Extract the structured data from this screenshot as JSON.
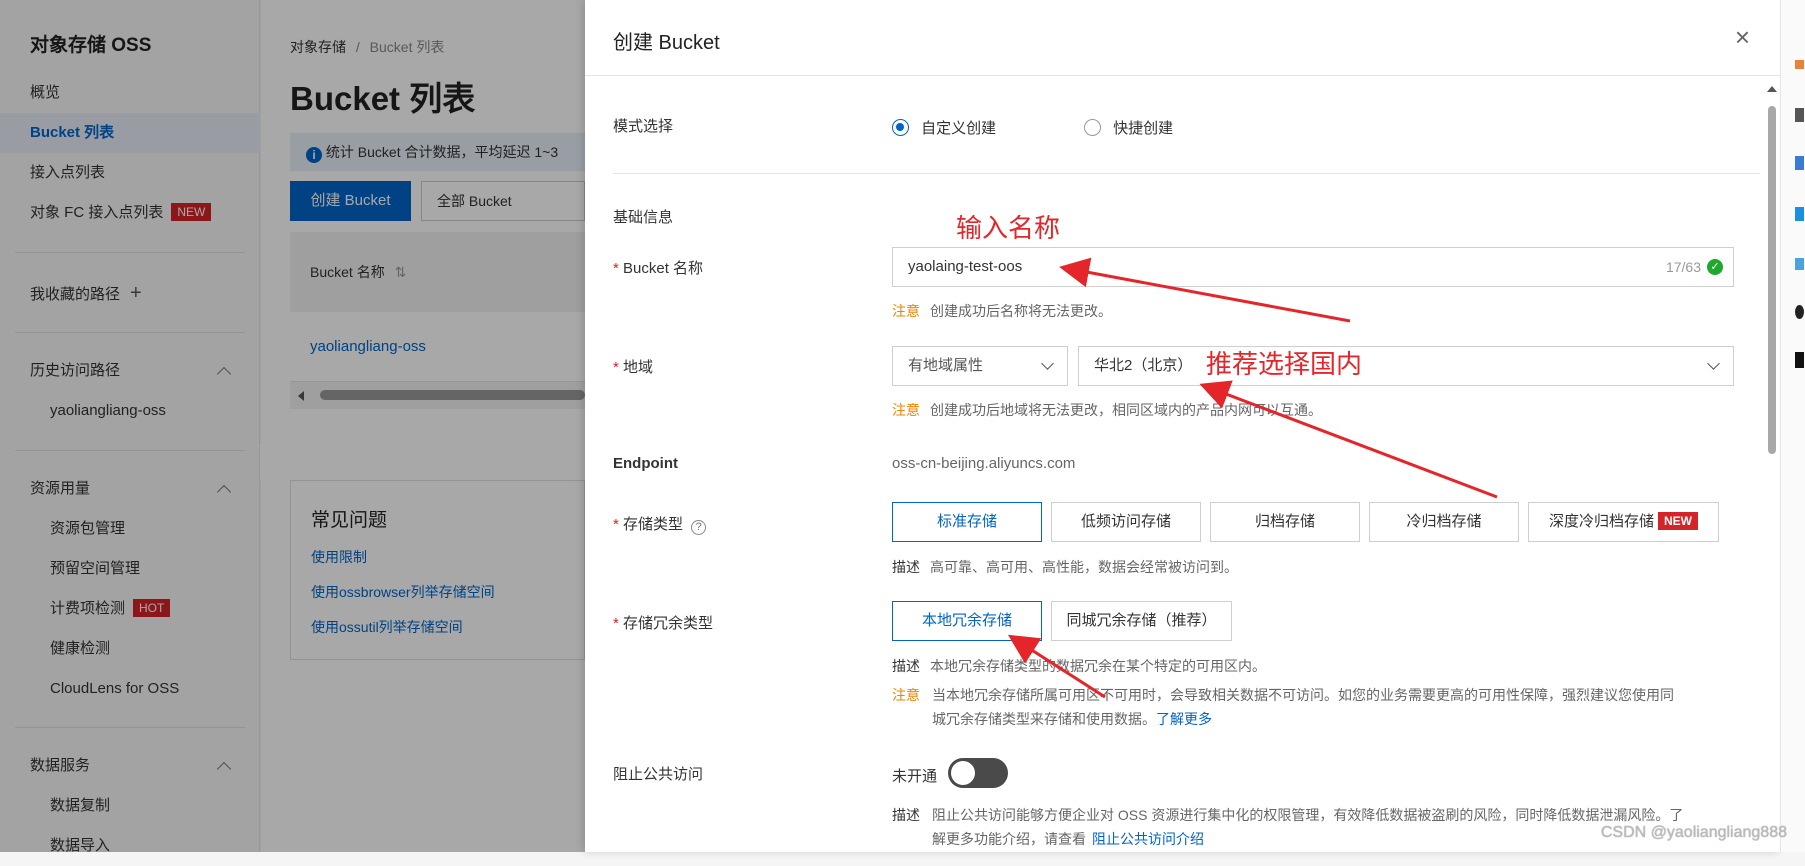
{
  "sidebar": {
    "title": "对象存储 OSS",
    "items": [
      {
        "label": "概览"
      },
      {
        "label": "Bucket 列表"
      },
      {
        "label": "接入点列表"
      },
      {
        "label": "对象 FC 接入点列表",
        "badge": "NEW"
      },
      {
        "label": "我收藏的路径"
      },
      {
        "label": "历史访问路径"
      },
      {
        "label": "yaoliangliang-oss"
      },
      {
        "label": "资源用量"
      },
      {
        "label": "资源包管理"
      },
      {
        "label": "预留空间管理"
      },
      {
        "label": "计费项检测",
        "badge": "HOT"
      },
      {
        "label": "健康检测"
      },
      {
        "label": "CloudLens for OSS"
      },
      {
        "label": "数据服务"
      },
      {
        "label": "数据复制"
      },
      {
        "label": "数据导入"
      }
    ]
  },
  "main": {
    "breadcrumb_root": "对象存储",
    "breadcrumb_sep": "/",
    "breadcrumb_current": "Bucket 列表",
    "title": "Bucket 列表",
    "info": "统计 Bucket 合计数据，平均延迟 1~3",
    "create_button": "创建 Bucket",
    "filter_select": "全部 Bucket",
    "column_header": "Bucket 名称",
    "row_name": "yaoliangliang-oss",
    "faq_title": "常见问题",
    "faq_links": [
      "使用限制",
      "使用ossbrowser列举存储空间",
      "使用ossutil列举存储空间"
    ]
  },
  "drawer": {
    "title": "创建 Bucket",
    "mode_label": "模式选择",
    "mode_options": [
      "自定义创建",
      "快捷创建"
    ],
    "section_basic": "基础信息",
    "name_label": "Bucket 名称",
    "name_value": "yaolaing-test-oos",
    "name_count": "17/63",
    "warn_word": "注意",
    "name_note": "创建成功后名称将无法更改。",
    "region_label": "地域",
    "region_attr": "有地域属性",
    "region_value": "华北2（北京）",
    "region_note": "创建成功后地域将无法更改，相同区域内的产品内网可以互通。",
    "endpoint_label": "Endpoint",
    "endpoint_value": "oss-cn-beijing.aliyuncs.com",
    "storage_label": "存储类型",
    "storage_options": [
      "标准存储",
      "低频访问存储",
      "归档存储",
      "冷归档存储",
      "深度冷归档存储"
    ],
    "storage_new_badge": "NEW",
    "desc_word": "描述",
    "storage_desc": "高可靠、高可用、高性能，数据会经常被访问到。",
    "redundancy_label": "存储冗余类型",
    "redundancy_options": [
      "本地冗余存储",
      "同城冗余存储（推荐）"
    ],
    "redundancy_desc": "本地冗余存储类型的数据冗余在某个特定的可用区内。",
    "redundancy_warn_1": "当本地冗余存储所属可用区不可用时，会导致相关数据不可访问。如您的业务需要更高的可用性保障，强烈建议您使用同",
    "redundancy_warn_2": "城冗余存储类型来存储和使用数据。",
    "learn_more": "了解更多",
    "public_label": "阻止公共访问",
    "toggle_state": "未开通",
    "public_desc_1": "阻止公共访问能够方便企业对 OSS 资源进行集中化的权限管理，有效降低数据被盗刷的风险，同时降低数据泄漏风险。了",
    "public_desc_2": "解更多功能介绍，请查看",
    "public_link": "阻止公共访问介绍"
  },
  "annotations": {
    "name_hint": "输入名称",
    "region_hint": "推荐选择国内",
    "color": "#e4262a"
  },
  "watermark": "CSDN @yaoliangliang888",
  "colors": {
    "accent": "#0064c8",
    "danger": "#d4242a",
    "warning": "#f58200"
  }
}
